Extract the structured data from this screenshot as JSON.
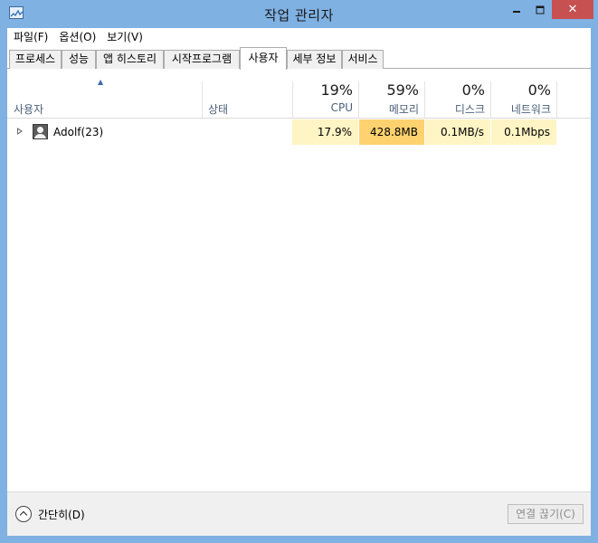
{
  "window": {
    "title": "작업 관리자"
  },
  "menu": [
    "파일(F)",
    "옵션(O)",
    "보기(V)"
  ],
  "tabs": [
    "프로세스",
    "성능",
    "앱 히스토리",
    "시작프로그램",
    "사용자",
    "세부 정보",
    "서비스"
  ],
  "active_tab": "사용자",
  "columns": {
    "user": "사용자",
    "status": "상태",
    "cpu": {
      "percent": "19%",
      "label": "CPU"
    },
    "memory": {
      "percent": "59%",
      "label": "메모리"
    },
    "disk": {
      "percent": "0%",
      "label": "디스크"
    },
    "network": {
      "percent": "0%",
      "label": "네트워크"
    }
  },
  "rows": [
    {
      "name": "Adolf(23)",
      "status": "",
      "cpu": "17.9%",
      "memory": "428.8MB",
      "disk": "0.1MB/s",
      "network": "0.1Mbps"
    }
  ],
  "footer": {
    "collapse_label": "간단히(D)",
    "disconnect_label": "연결 끊기(C)"
  },
  "colors": {
    "heat_low": "#fff4c4",
    "heat_high": "#ffd270",
    "title_bar": "#7fb1e3",
    "close_button": "#c75050"
  }
}
